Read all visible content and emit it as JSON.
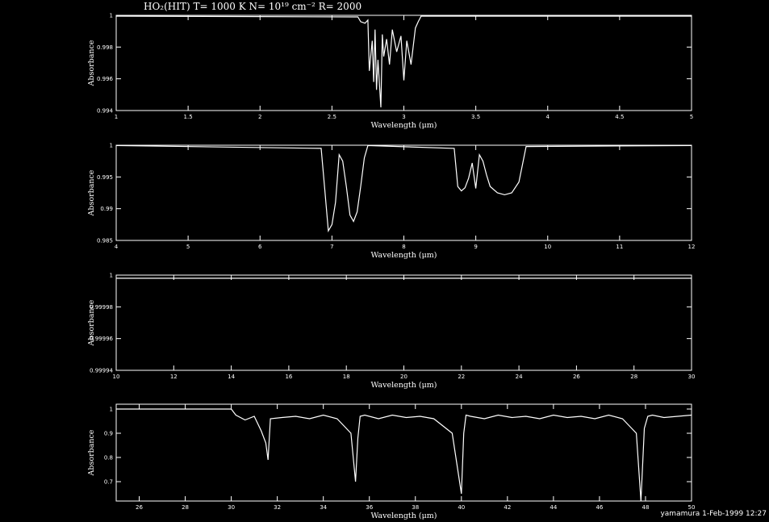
{
  "figure": {
    "title": "HO₂(HIT) T= 1000 K N= 10¹⁹ cm⁻² R= 2000",
    "credit": "yamamura  1-Feb-1999 12:27"
  },
  "chart_data": [
    {
      "type": "line",
      "xlabel": "Wavelength (μm)",
      "ylabel": "Absorbance",
      "xlim": [
        1,
        5
      ],
      "ylim": [
        0.994,
        1.0
      ],
      "xticks": [
        "1",
        "1.5",
        "2",
        "2.5",
        "3",
        "3.5",
        "4",
        "4.5",
        "5"
      ],
      "yticks": [
        "0.994",
        "0.996",
        "0.998",
        "1"
      ],
      "series": [
        {
          "x": [
            1.0,
            2.68,
            2.7,
            2.73,
            2.75,
            2.76,
            2.78,
            2.79,
            2.8,
            2.81,
            2.82,
            2.84,
            2.85,
            2.86,
            2.88,
            2.9,
            2.92,
            2.95,
            2.98,
            3.0,
            3.02,
            3.05,
            3.08,
            3.1,
            3.12,
            5.0
          ],
          "y": [
            0.99995,
            0.9999,
            0.9996,
            0.9995,
            0.9997,
            0.9965,
            0.9984,
            0.9958,
            0.9991,
            0.9953,
            0.9972,
            0.9942,
            0.9988,
            0.9974,
            0.9985,
            0.9969,
            0.9991,
            0.9977,
            0.9987,
            0.9959,
            0.9984,
            0.9969,
            0.9992,
            0.9996,
            0.99995,
            0.99995
          ]
        }
      ]
    },
    {
      "type": "line",
      "xlabel": "Wavelength (μm)",
      "ylabel": "Absorbance",
      "xlim": [
        4,
        12
      ],
      "ylim": [
        0.985,
        1.0
      ],
      "xticks": [
        "4",
        "5",
        "6",
        "7",
        "8",
        "9",
        "10",
        "11",
        "12"
      ],
      "yticks": [
        "0.985",
        "0.99",
        "0.995",
        "1"
      ],
      "series": [
        {
          "x": [
            4.0,
            6.85,
            6.9,
            6.95,
            7.0,
            7.05,
            7.1,
            7.15,
            7.2,
            7.25,
            7.3,
            7.35,
            7.4,
            7.45,
            7.5,
            8.7,
            8.75,
            8.8,
            8.85,
            8.9,
            8.95,
            9.0,
            9.05,
            9.1,
            9.15,
            9.2,
            9.3,
            9.4,
            9.5,
            9.6,
            9.7,
            12.0
          ],
          "y": [
            0.99995,
            0.9995,
            0.993,
            0.9865,
            0.9875,
            0.991,
            0.9985,
            0.9975,
            0.9935,
            0.989,
            0.988,
            0.9895,
            0.9935,
            0.998,
            0.99995,
            0.9995,
            0.9935,
            0.9928,
            0.9933,
            0.9948,
            0.9972,
            0.9932,
            0.9985,
            0.9975,
            0.9953,
            0.9935,
            0.9925,
            0.9922,
            0.9925,
            0.9942,
            0.9998,
            0.99995
          ]
        }
      ]
    },
    {
      "type": "line",
      "xlabel": "Wavelength (μm)",
      "ylabel": "Absorbance",
      "xlim": [
        10,
        30
      ],
      "ylim": [
        0.99994,
        1.0
      ],
      "xticks": [
        "10",
        "12",
        "14",
        "16",
        "18",
        "20",
        "22",
        "24",
        "26",
        "28",
        "30"
      ],
      "yticks": [
        "0.99994",
        "0.99996",
        "0.99998",
        "1"
      ],
      "series": [
        {
          "x": [
            10,
            30
          ],
          "y": [
            0.999998,
            0.999998
          ]
        }
      ]
    },
    {
      "type": "line",
      "xlabel": "Wavelength (μm)",
      "ylabel": "Absorbance",
      "xlim": [
        25,
        50
      ],
      "ylim": [
        0.62,
        1.02
      ],
      "xticks": [
        "26",
        "28",
        "30",
        "32",
        "34",
        "36",
        "38",
        "40",
        "42",
        "44",
        "46",
        "48",
        "50"
      ],
      "yticks": [
        "0.7",
        "0.8",
        "0.9",
        "1"
      ],
      "series": [
        {
          "x": [
            25.0,
            30.0,
            30.2,
            30.6,
            31.0,
            31.3,
            31.5,
            31.6,
            31.7,
            32.2,
            32.8,
            33.4,
            34.0,
            34.6,
            35.2,
            35.4,
            35.5,
            35.6,
            35.8,
            36.4,
            37.0,
            37.6,
            38.2,
            38.8,
            39.6,
            40.0,
            40.1,
            40.2,
            40.4,
            41.0,
            41.6,
            42.2,
            42.8,
            43.4,
            44.0,
            44.6,
            45.2,
            45.8,
            46.4,
            47.0,
            47.6,
            47.8,
            47.95,
            48.1,
            48.3,
            48.8,
            49.4,
            50.0
          ],
          "y": [
            1.0,
            1.0,
            0.975,
            0.955,
            0.97,
            0.91,
            0.86,
            0.79,
            0.96,
            0.965,
            0.97,
            0.96,
            0.975,
            0.96,
            0.9,
            0.7,
            0.88,
            0.97,
            0.975,
            0.96,
            0.975,
            0.965,
            0.97,
            0.96,
            0.9,
            0.65,
            0.9,
            0.975,
            0.97,
            0.96,
            0.975,
            0.965,
            0.97,
            0.96,
            0.975,
            0.965,
            0.97,
            0.96,
            0.975,
            0.96,
            0.9,
            0.62,
            0.92,
            0.97,
            0.975,
            0.965,
            0.97,
            0.975
          ]
        }
      ]
    }
  ]
}
